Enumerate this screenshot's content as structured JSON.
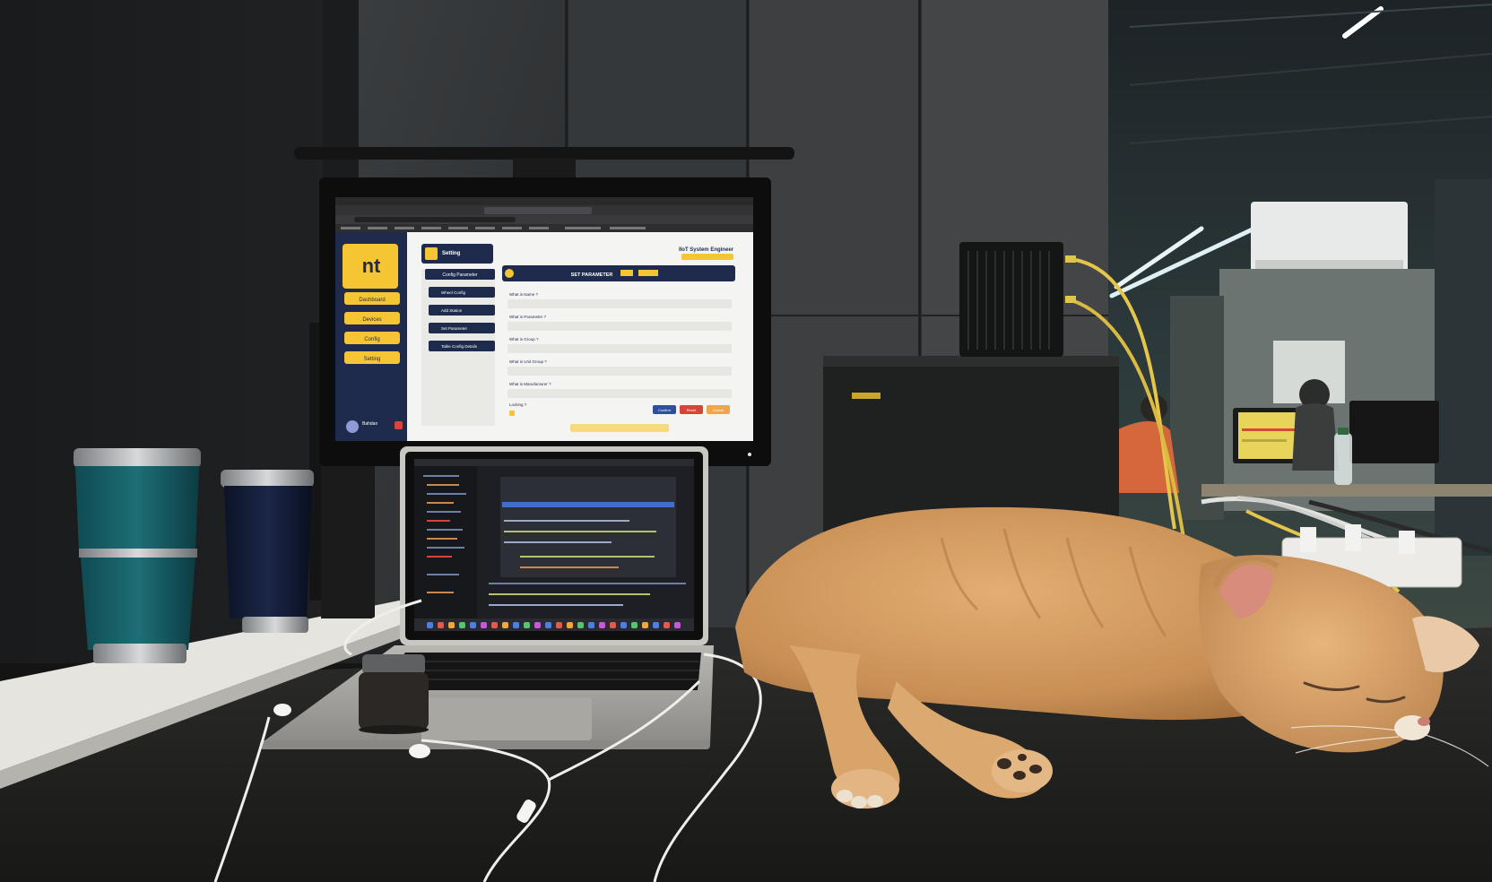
{
  "monitor_app": {
    "logo_text": "nt",
    "page_title": "Setting",
    "user_title": "IIoT System Engineer",
    "nav_items": [
      "Dashboard",
      "Devices",
      "Config",
      "Setting"
    ],
    "sub_nav_items": [
      "Config Parameter",
      "Wheel Config",
      "Add Station",
      "Set Parameter",
      "Table Config Details"
    ],
    "panel_header": "SET PARAMETER",
    "form_labels": [
      "What is Name ?",
      "What is Parameter ?",
      "What is Group ?",
      "What is Unit Group ?",
      "What is Manufacturer ?",
      "Locking ?"
    ],
    "buttons": [
      "Confirm",
      "Reset",
      "Cancel"
    ],
    "user_name": "Bahdan"
  },
  "colors": {
    "accent_yellow": "#f5c534",
    "sidebar_navy": "#1f2b4d",
    "confirm_blue": "#2e4fa0",
    "reset_red": "#d6443a",
    "cancel_orange": "#efa64a",
    "cat_orange": "#d69a5c"
  },
  "icons": {
    "cat": "sleeping-cat",
    "tumblers": "tumbler-cups",
    "earphones": "wired-earphones"
  }
}
